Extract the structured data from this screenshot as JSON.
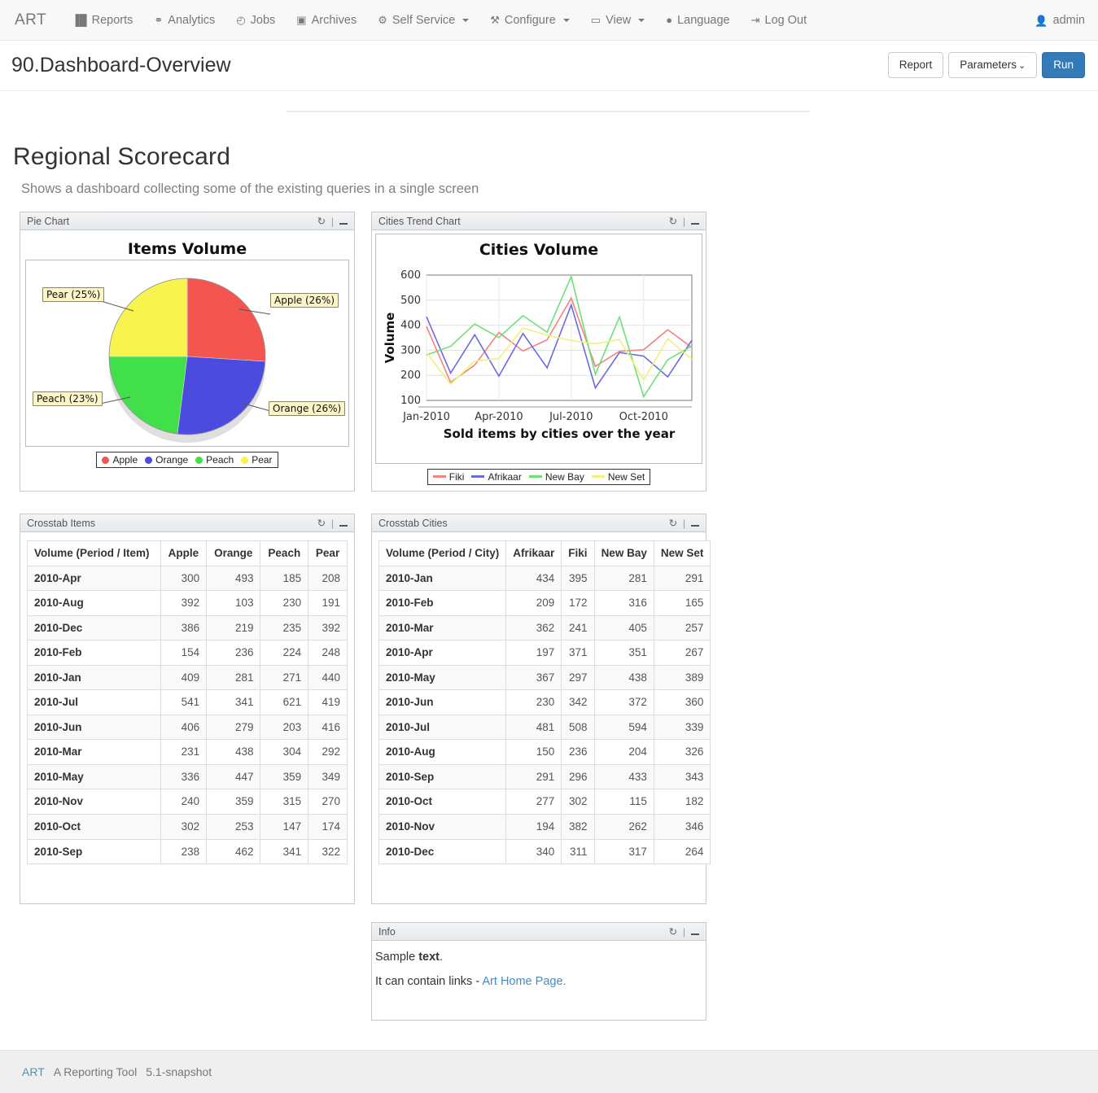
{
  "navbar": {
    "brand": "ART",
    "items": [
      {
        "label": "Reports",
        "icon": "bar-chart-icon",
        "glyph": "▐█",
        "caret": false
      },
      {
        "label": "Analytics",
        "icon": "sitemap-icon",
        "glyph": "⚭",
        "caret": false
      },
      {
        "label": "Jobs",
        "icon": "clock-icon",
        "glyph": "◴",
        "caret": false
      },
      {
        "label": "Archives",
        "icon": "archive-icon",
        "glyph": "▣",
        "caret": false
      },
      {
        "label": "Self Service",
        "icon": "gear-icon",
        "glyph": "⚙",
        "caret": true
      },
      {
        "label": "Configure",
        "icon": "wrench-icon",
        "glyph": "⚒",
        "caret": true
      },
      {
        "label": "View",
        "icon": "desktop-icon",
        "glyph": "▭",
        "caret": true
      },
      {
        "label": "Language",
        "icon": "comment-icon",
        "glyph": "●",
        "caret": false
      },
      {
        "label": "Log Out",
        "icon": "signout-icon",
        "glyph": "⇥",
        "caret": false
      }
    ],
    "user": "admin",
    "user_icon": "user-icon"
  },
  "report_header": {
    "title": "90.Dashboard-Overview",
    "buttons": {
      "report": "Report",
      "parameters": "Parameters",
      "parameters_caret": "⌄",
      "run": "Run"
    }
  },
  "dashboard": {
    "title": "Regional Scorecard",
    "subtitle": "Shows a dashboard collecting some of the existing queries in a single screen"
  },
  "panel_icons": {
    "refresh": "refresh-icon",
    "refresh_glyph": "↻",
    "separator": "|",
    "minimize": "minimize-icon",
    "minimize_glyph": "—"
  },
  "panels": {
    "pie": {
      "title": "Pie Chart"
    },
    "trend": {
      "title": "Cities Trend Chart"
    },
    "xitems": {
      "title": "Crosstab Items"
    },
    "xcities": {
      "title": "Crosstab Cities"
    },
    "info": {
      "title": "Info"
    }
  },
  "info": {
    "line1_plain": "Sample ",
    "line1_bold": "text",
    "line1_end": ".",
    "line2_text": "It can contain links",
    "line2_dash": " - ",
    "line2_link": "Art Home Page."
  },
  "footer": {
    "brand": "ART",
    "name": "A Reporting Tool",
    "version": "5.1-snapshot"
  },
  "chart_data": [
    {
      "type": "pie",
      "title": "Items Volume",
      "labels": [
        "Apple",
        "Orange",
        "Peach",
        "Pear"
      ],
      "percents": [
        26,
        26,
        23,
        25
      ],
      "colors": [
        "#f4554f",
        "#4b4be0",
        "#41e04b",
        "#f7f44d"
      ],
      "callouts": [
        "Apple (26%)",
        "Orange (26%)",
        "Peach (23%)",
        "Pear (25%)"
      ],
      "legend": [
        "Apple",
        "Orange",
        "Peach",
        "Pear"
      ],
      "legend_position": "bottom"
    },
    {
      "type": "line",
      "title": "Cities Volume",
      "xlabel": "Sold items by cities over the year",
      "ylabel": "Volume",
      "x": [
        "Jan-2010",
        "Feb-2010",
        "Mar-2010",
        "Apr-2010",
        "May-2010",
        "Jun-2010",
        "Jul-2010",
        "Aug-2010",
        "Sep-2010",
        "Oct-2010",
        "Nov-2010",
        "Dec-2010"
      ],
      "xticks": [
        "Jan-2010",
        "Apr-2010",
        "Jul-2010",
        "Oct-2010"
      ],
      "yticks": [
        100,
        200,
        300,
        400,
        500,
        600
      ],
      "ylim": [
        100,
        600
      ],
      "grid": true,
      "legend_position": "bottom",
      "series": [
        {
          "name": "Fiki",
          "color": "#f4827f",
          "values": [
            395,
            172,
            241,
            371,
            297,
            342,
            508,
            236,
            296,
            302,
            382,
            311
          ]
        },
        {
          "name": "Afrikaar",
          "color": "#6b6be0",
          "values": [
            434,
            209,
            362,
            197,
            367,
            230,
            481,
            150,
            291,
            277,
            194,
            340
          ]
        },
        {
          "name": "New Bay",
          "color": "#6fdf79",
          "values": [
            281,
            316,
            405,
            351,
            438,
            372,
            594,
            204,
            433,
            115,
            262,
            317
          ]
        },
        {
          "name": "New Set",
          "color": "#f2f07a",
          "values": [
            291,
            165,
            257,
            267,
            389,
            360,
            339,
            326,
            343,
            182,
            346,
            264
          ]
        }
      ]
    },
    {
      "type": "table",
      "title": "Crosstab Items",
      "columns": [
        "Volume (Period / Item)",
        "Apple",
        "Orange",
        "Peach",
        "Pear"
      ],
      "rows": [
        [
          "2010-Apr",
          "300",
          "493",
          "185",
          "208"
        ],
        [
          "2010-Aug",
          "392",
          "103",
          "230",
          "191"
        ],
        [
          "2010-Dec",
          "386",
          "219",
          "235",
          "392"
        ],
        [
          "2010-Feb",
          "154",
          "236",
          "224",
          "248"
        ],
        [
          "2010-Jan",
          "409",
          "281",
          "271",
          "440"
        ],
        [
          "2010-Jul",
          "541",
          "341",
          "621",
          "419"
        ],
        [
          "2010-Jun",
          "406",
          "279",
          "203",
          "416"
        ],
        [
          "2010-Mar",
          "231",
          "438",
          "304",
          "292"
        ],
        [
          "2010-May",
          "336",
          "447",
          "359",
          "349"
        ],
        [
          "2010-Nov",
          "240",
          "359",
          "315",
          "270"
        ],
        [
          "2010-Oct",
          "302",
          "253",
          "147",
          "174"
        ],
        [
          "2010-Sep",
          "238",
          "462",
          "341",
          "322"
        ]
      ]
    },
    {
      "type": "table",
      "title": "Crosstab Cities",
      "columns": [
        "Volume (Period / City)",
        "Afrikaar",
        "Fiki",
        "New Bay",
        "New Set"
      ],
      "rows": [
        [
          "2010-Jan",
          "434",
          "395",
          "281",
          "291"
        ],
        [
          "2010-Feb",
          "209",
          "172",
          "316",
          "165"
        ],
        [
          "2010-Mar",
          "362",
          "241",
          "405",
          "257"
        ],
        [
          "2010-Apr",
          "197",
          "371",
          "351",
          "267"
        ],
        [
          "2010-May",
          "367",
          "297",
          "438",
          "389"
        ],
        [
          "2010-Jun",
          "230",
          "342",
          "372",
          "360"
        ],
        [
          "2010-Jul",
          "481",
          "508",
          "594",
          "339"
        ],
        [
          "2010-Aug",
          "150",
          "236",
          "204",
          "326"
        ],
        [
          "2010-Sep",
          "291",
          "296",
          "433",
          "343"
        ],
        [
          "2010-Oct",
          "277",
          "302",
          "115",
          "182"
        ],
        [
          "2010-Nov",
          "194",
          "382",
          "262",
          "346"
        ],
        [
          "2010-Dec",
          "340",
          "311",
          "317",
          "264"
        ]
      ]
    }
  ]
}
